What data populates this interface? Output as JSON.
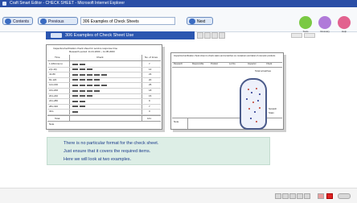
{
  "window": {
    "title": "Craft Smart Editor - CHECK SHEET - Microsoft Internet Explorer"
  },
  "toolbar": {
    "contents_label": "Contents",
    "previous_label": "Previous",
    "breadcrumb": "306 Examples of Check Sheets",
    "next_label": "Next",
    "tools": [
      {
        "label": "Tools",
        "icon": "tools-icon",
        "color": "#7ac943"
      },
      {
        "label": "Glossary",
        "icon": "glossary-icon",
        "color": "#b07ad9"
      },
      {
        "label": "Help",
        "icon": "help-icon",
        "color": "#e2628f"
      }
    ]
  },
  "section": {
    "title": "306 Examples of Check Sheet Use"
  },
  "sheet_left": {
    "title": "Inspection/verification check sheet for service response time",
    "subtitle": "Research period: 11.01.2003 ~ 11.05.2003",
    "col_time": "Time",
    "col_check": "Check",
    "col_count": "No. of times",
    "rows": [
      {
        "time": "1 (Minimum)",
        "count": "7"
      },
      {
        "time": "2(1-40)",
        "count": "14"
      },
      {
        "time": "41-80",
        "count": "23"
      },
      {
        "time": "81-120",
        "count": "20"
      },
      {
        "time": "121-160",
        "count": "25"
      },
      {
        "time": "161-200",
        "count": "18"
      },
      {
        "time": "201-240",
        "count": "15"
      },
      {
        "time": "241-280",
        "count": "9"
      },
      {
        "time": "281-320",
        "count": "7"
      },
      {
        "time": "321-",
        "count": "3"
      }
    ],
    "total_label": "Total",
    "total_value": "141",
    "note_label": "Note"
  },
  "sheet_right": {
    "title": "Inspection/verification check sheet to check stains and scratches on containers and label of cosmetic products",
    "headers": [
      "Research",
      "Responsible",
      "Product",
      "Lot No.",
      "Inspector",
      "Check"
    ],
    "total_label": "Total scratches",
    "note_label": "Note",
    "legend": [
      "Scratch",
      "Stain"
    ]
  },
  "message": {
    "line1": "There is no particular format for the check sheet.",
    "line2": "Just ensure that it covers the required items.",
    "line3": "Here we will look at two examples."
  }
}
